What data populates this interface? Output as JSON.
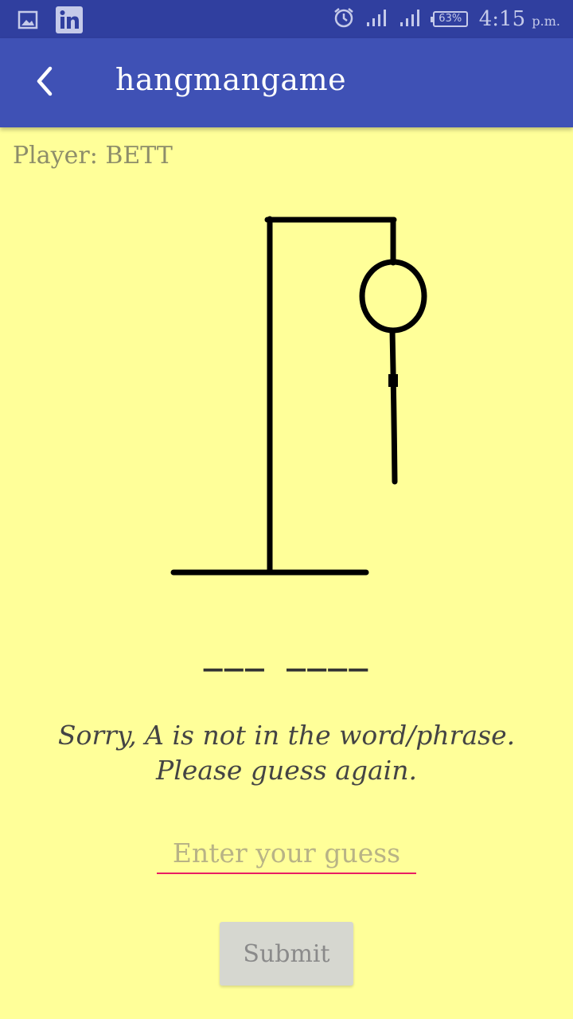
{
  "status_bar": {
    "battery": "63%",
    "time": "4:15",
    "time_suffix": "p.m.",
    "icons": [
      "gallery-icon",
      "linkedin-icon",
      "alarm-icon",
      "signal-icon",
      "signal-icon",
      "battery-icon"
    ]
  },
  "app_bar": {
    "title": "hangmangame",
    "back_icon": "chevron-left-icon"
  },
  "game": {
    "player_label": "Player: BETT",
    "word_blanks": "___ ____",
    "message_line1": "Sorry, A is not in the word/phrase.",
    "message_line2": "Please guess again."
  },
  "guess": {
    "value": "",
    "placeholder": "Enter your guess"
  },
  "submit": {
    "label": "Submit"
  },
  "colors": {
    "status_bar": "#303f9f",
    "app_bar": "#3f51b5",
    "background": "#ffff99",
    "accent": "#e91e63",
    "button": "#d6d7d0"
  }
}
